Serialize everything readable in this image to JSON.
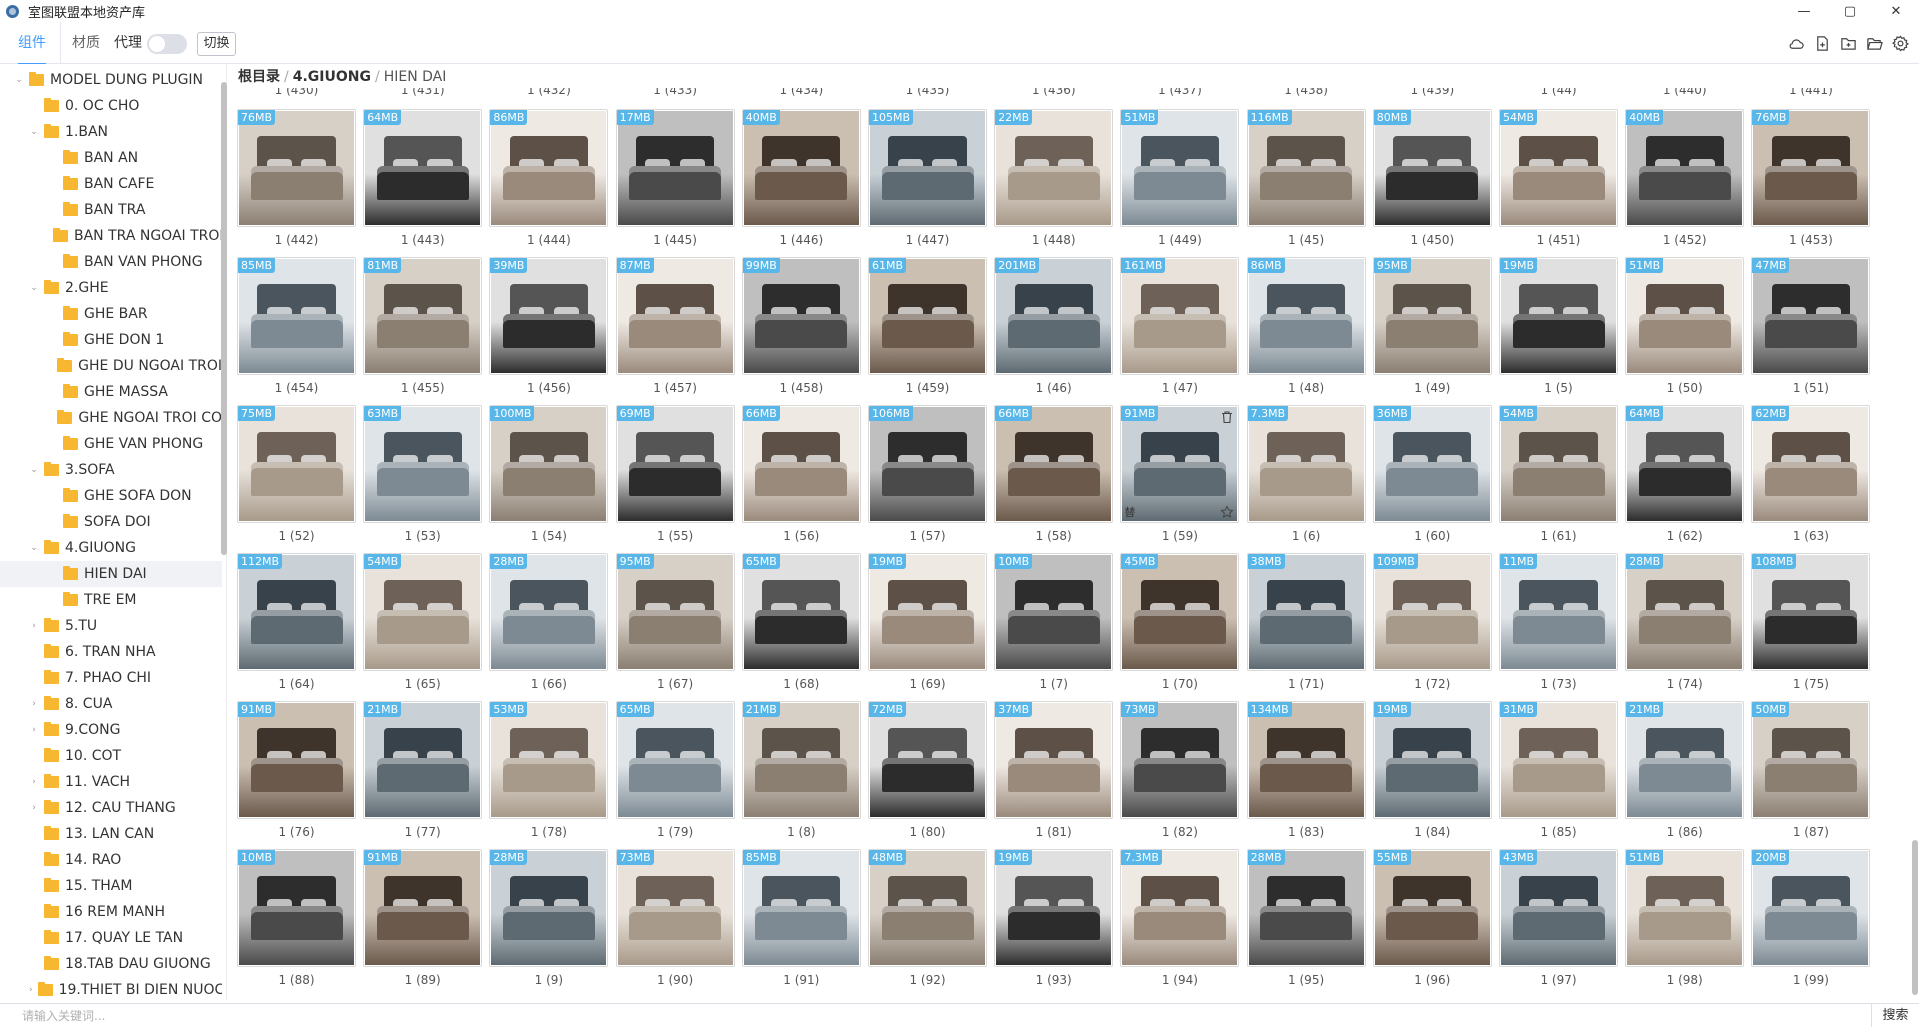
{
  "window": {
    "title": "室图联盟本地资产库",
    "controls": {
      "minimize": "—",
      "maximize": "▢",
      "close": "✕"
    }
  },
  "toolbar": {
    "tabs": [
      {
        "label": "组件",
        "active": true
      },
      {
        "label": "材质",
        "active": false
      }
    ],
    "proxy_label": "代理",
    "proxy_enabled": false,
    "switch_label": "切换",
    "icons": [
      "cloud-icon",
      "new-file-icon",
      "new-folder-icon",
      "open-folder-icon",
      "settings-icon"
    ]
  },
  "sidebar": {
    "items": [
      {
        "label": "MODEL DUNG PLUGIN",
        "level": 0,
        "caret": "open"
      },
      {
        "label": "0. OC CHO",
        "level": 1,
        "caret": "none"
      },
      {
        "label": "1.BAN",
        "level": 1,
        "caret": "open"
      },
      {
        "label": "BAN AN",
        "level": 2,
        "caret": "none"
      },
      {
        "label": "BAN CAFE",
        "level": 2,
        "caret": "none"
      },
      {
        "label": "BAN TRA",
        "level": 2,
        "caret": "none"
      },
      {
        "label": "BAN TRA NGOAI TROI",
        "level": 2,
        "caret": "none"
      },
      {
        "label": "BAN VAN PHONG",
        "level": 2,
        "caret": "none"
      },
      {
        "label": "2.GHE",
        "level": 1,
        "caret": "open"
      },
      {
        "label": "GHE BAR",
        "level": 2,
        "caret": "none"
      },
      {
        "label": "GHE DON 1",
        "level": 2,
        "caret": "none"
      },
      {
        "label": "GHE DU NGOAI TROI",
        "level": 2,
        "caret": "none"
      },
      {
        "label": "GHE MASSA",
        "level": 2,
        "caret": "none"
      },
      {
        "label": "GHE NGOAI TROI CO",
        "level": 2,
        "caret": "none"
      },
      {
        "label": "GHE VAN PHONG",
        "level": 2,
        "caret": "none"
      },
      {
        "label": "3.SOFA",
        "level": 1,
        "caret": "open"
      },
      {
        "label": "GHE SOFA DON",
        "level": 2,
        "caret": "none"
      },
      {
        "label": "SOFA DOI",
        "level": 2,
        "caret": "none"
      },
      {
        "label": "4.GIUONG",
        "level": 1,
        "caret": "open"
      },
      {
        "label": "HIEN DAI",
        "level": 2,
        "caret": "none",
        "selected": true
      },
      {
        "label": "TRE EM",
        "level": 2,
        "caret": "none"
      },
      {
        "label": "5.TU",
        "level": 1,
        "caret": "closed"
      },
      {
        "label": "6. TRAN NHA",
        "level": 1,
        "caret": "none"
      },
      {
        "label": "7. PHAO CHI",
        "level": 1,
        "caret": "none"
      },
      {
        "label": "8. CUA",
        "level": 1,
        "caret": "closed"
      },
      {
        "label": "9.CONG",
        "level": 1,
        "caret": "closed"
      },
      {
        "label": "10. COT",
        "level": 1,
        "caret": "none"
      },
      {
        "label": "11. VACH",
        "level": 1,
        "caret": "closed"
      },
      {
        "label": "12. CAU THANG",
        "level": 1,
        "caret": "closed"
      },
      {
        "label": "13. LAN CAN",
        "level": 1,
        "caret": "none"
      },
      {
        "label": "14. RAO",
        "level": 1,
        "caret": "none"
      },
      {
        "label": "15. THAM",
        "level": 1,
        "caret": "none"
      },
      {
        "label": "16 REM MANH",
        "level": 1,
        "caret": "none"
      },
      {
        "label": "17. QUAY LE TAN",
        "level": 1,
        "caret": "none"
      },
      {
        "label": "18.TAB DAU GIUONG",
        "level": 1,
        "caret": "none"
      },
      {
        "label": "19.THIET BI DIEN NUOC",
        "level": 1,
        "caret": "closed"
      }
    ]
  },
  "breadcrumb": {
    "root": "根目录",
    "separator": "/",
    "parent": "4.GIUONG",
    "current": "HIEN DAI"
  },
  "grid": {
    "top_partial_captions": [
      "1 (430)",
      "1 (431)",
      "1 (432)",
      "1 (433)",
      "1 (434)",
      "1 (435)",
      "1 (436)",
      "1 (437)",
      "1 (438)",
      "1 (439)",
      "1 (44)",
      "1 (440)",
      "1 (441)"
    ],
    "rows": [
      [
        {
          "size": "76MB",
          "name": "1 (442)"
        },
        {
          "size": "64MB",
          "name": "1 (443)"
        },
        {
          "size": "86MB",
          "name": "1 (444)"
        },
        {
          "size": "17MB",
          "name": "1 (445)"
        },
        {
          "size": "40MB",
          "name": "1 (446)"
        },
        {
          "size": "105MB",
          "name": "1 (447)"
        },
        {
          "size": "22MB",
          "name": "1 (448)"
        },
        {
          "size": "51MB",
          "name": "1 (449)"
        },
        {
          "size": "116MB",
          "name": "1 (45)"
        },
        {
          "size": "80MB",
          "name": "1 (450)"
        },
        {
          "size": "54MB",
          "name": "1 (451)"
        },
        {
          "size": "40MB",
          "name": "1 (452)"
        },
        {
          "size": "76MB",
          "name": "1 (453)"
        }
      ],
      [
        {
          "size": "85MB",
          "name": "1 (454)"
        },
        {
          "size": "81MB",
          "name": "1 (455)"
        },
        {
          "size": "39MB",
          "name": "1 (456)"
        },
        {
          "size": "87MB",
          "name": "1 (457)"
        },
        {
          "size": "99MB",
          "name": "1 (458)"
        },
        {
          "size": "61MB",
          "name": "1 (459)"
        },
        {
          "size": "201MB",
          "name": "1 (46)"
        },
        {
          "size": "161MB",
          "name": "1 (47)"
        },
        {
          "size": "86MB",
          "name": "1 (48)"
        },
        {
          "size": "95MB",
          "name": "1 (49)"
        },
        {
          "size": "19MB",
          "name": "1 (5)"
        },
        {
          "size": "51MB",
          "name": "1 (50)"
        },
        {
          "size": "47MB",
          "name": "1 (51)"
        }
      ],
      [
        {
          "size": "75MB",
          "name": "1 (52)"
        },
        {
          "size": "63MB",
          "name": "1 (53)"
        },
        {
          "size": "100MB",
          "name": "1 (54)"
        },
        {
          "size": "69MB",
          "name": "1 (55)"
        },
        {
          "size": "66MB",
          "name": "1 (56)"
        },
        {
          "size": "106MB",
          "name": "1 (57)"
        },
        {
          "size": "66MB",
          "name": "1 (58)"
        },
        {
          "size": "91MB",
          "name": "1 (59)",
          "hovered": true,
          "hover_char": "替"
        },
        {
          "size": "7.3MB",
          "name": "1 (6)"
        },
        {
          "size": "36MB",
          "name": "1 (60)"
        },
        {
          "size": "54MB",
          "name": "1 (61)"
        },
        {
          "size": "64MB",
          "name": "1 (62)"
        },
        {
          "size": "62MB",
          "name": "1 (63)"
        }
      ],
      [
        {
          "size": "112MB",
          "name": "1 (64)"
        },
        {
          "size": "54MB",
          "name": "1 (65)"
        },
        {
          "size": "28MB",
          "name": "1 (66)"
        },
        {
          "size": "95MB",
          "name": "1 (67)"
        },
        {
          "size": "65MB",
          "name": "1 (68)"
        },
        {
          "size": "19MB",
          "name": "1 (69)"
        },
        {
          "size": "10MB",
          "name": "1 (7)"
        },
        {
          "size": "45MB",
          "name": "1 (70)"
        },
        {
          "size": "38MB",
          "name": "1 (71)"
        },
        {
          "size": "109MB",
          "name": "1 (72)"
        },
        {
          "size": "11MB",
          "name": "1 (73)"
        },
        {
          "size": "28MB",
          "name": "1 (74)"
        },
        {
          "size": "108MB",
          "name": "1 (75)"
        }
      ],
      [
        {
          "size": "91MB",
          "name": "1 (76)"
        },
        {
          "size": "21MB",
          "name": "1 (77)"
        },
        {
          "size": "53MB",
          "name": "1 (78)"
        },
        {
          "size": "65MB",
          "name": "1 (79)"
        },
        {
          "size": "21MB",
          "name": "1 (8)"
        },
        {
          "size": "72MB",
          "name": "1 (80)"
        },
        {
          "size": "37MB",
          "name": "1 (81)"
        },
        {
          "size": "73MB",
          "name": "1 (82)"
        },
        {
          "size": "134MB",
          "name": "1 (83)"
        },
        {
          "size": "19MB",
          "name": "1 (84)"
        },
        {
          "size": "31MB",
          "name": "1 (85)"
        },
        {
          "size": "21MB",
          "name": "1 (86)"
        },
        {
          "size": "50MB",
          "name": "1 (87)"
        }
      ],
      [
        {
          "size": "10MB",
          "name": "1 (88)"
        },
        {
          "size": "91MB",
          "name": "1 (89)"
        },
        {
          "size": "28MB",
          "name": "1 (9)"
        },
        {
          "size": "73MB",
          "name": "1 (90)"
        },
        {
          "size": "85MB",
          "name": "1 (91)"
        },
        {
          "size": "48MB",
          "name": "1 (92)"
        },
        {
          "size": "19MB",
          "name": "1 (93)"
        },
        {
          "size": "7.3MB",
          "name": "1 (94)"
        },
        {
          "size": "28MB",
          "name": "1 (95)"
        },
        {
          "size": "55MB",
          "name": "1 (96)"
        },
        {
          "size": "43MB",
          "name": "1 (97)"
        },
        {
          "size": "51MB",
          "name": "1 (98)"
        },
        {
          "size": "20MB",
          "name": "1 (99)"
        }
      ]
    ]
  },
  "search": {
    "placeholder": "请输入关键词...",
    "value": "",
    "button_label": "搜索"
  },
  "colors": {
    "accent": "#409eff",
    "size_badge": "#58b7e8",
    "folder": "#f7b731",
    "selected_row": "#f0f2f5"
  }
}
